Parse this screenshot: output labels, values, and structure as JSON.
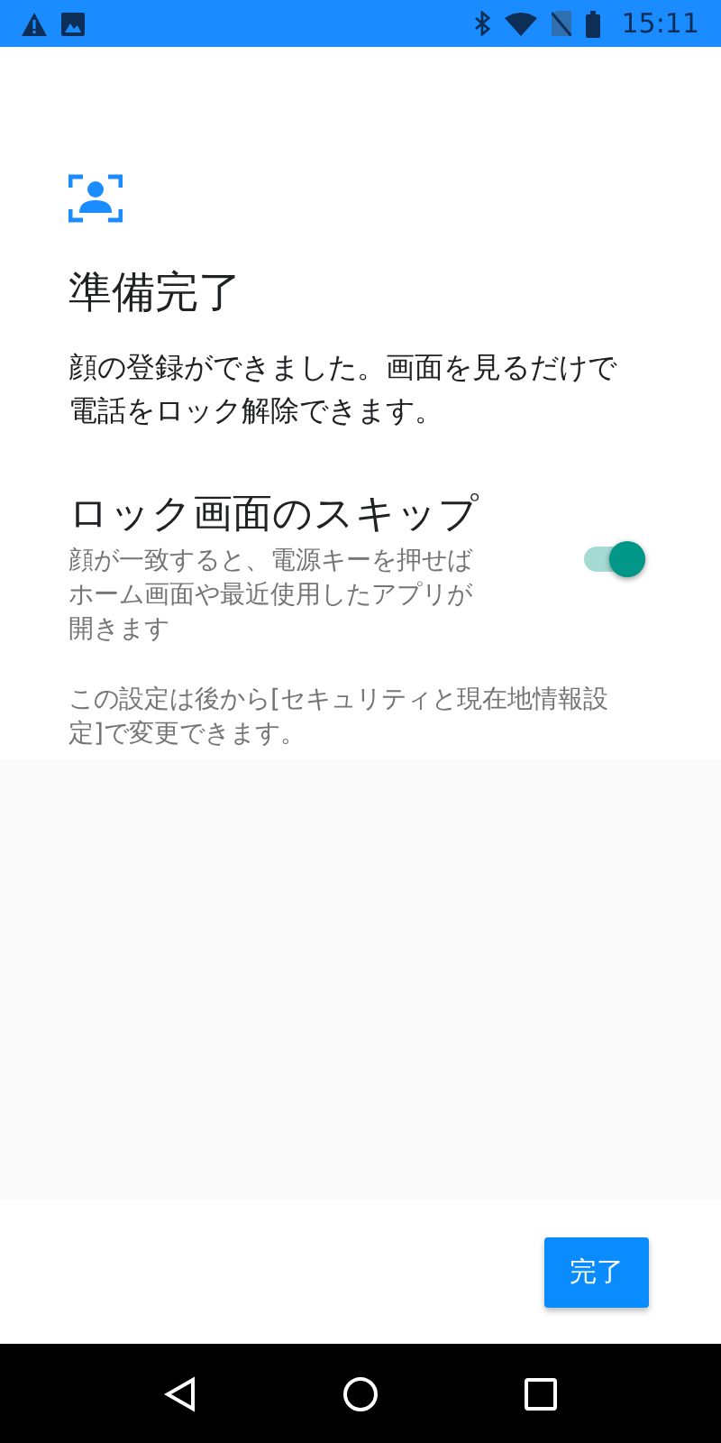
{
  "status_bar": {
    "time": "15:11"
  },
  "title": "準備完了",
  "message": "顔の登録ができました。画面を見るだけで電話をロック解除できます。",
  "setting": {
    "title": "ロック画面のスキップ",
    "description": "顔が一致すると、電源キーを押せばホーム画面や最近使用したアプリが開きます",
    "on": true
  },
  "note": "この設定は後から[セキュリティと現在地情報設定]で変更できます。",
  "done_button": "完了"
}
